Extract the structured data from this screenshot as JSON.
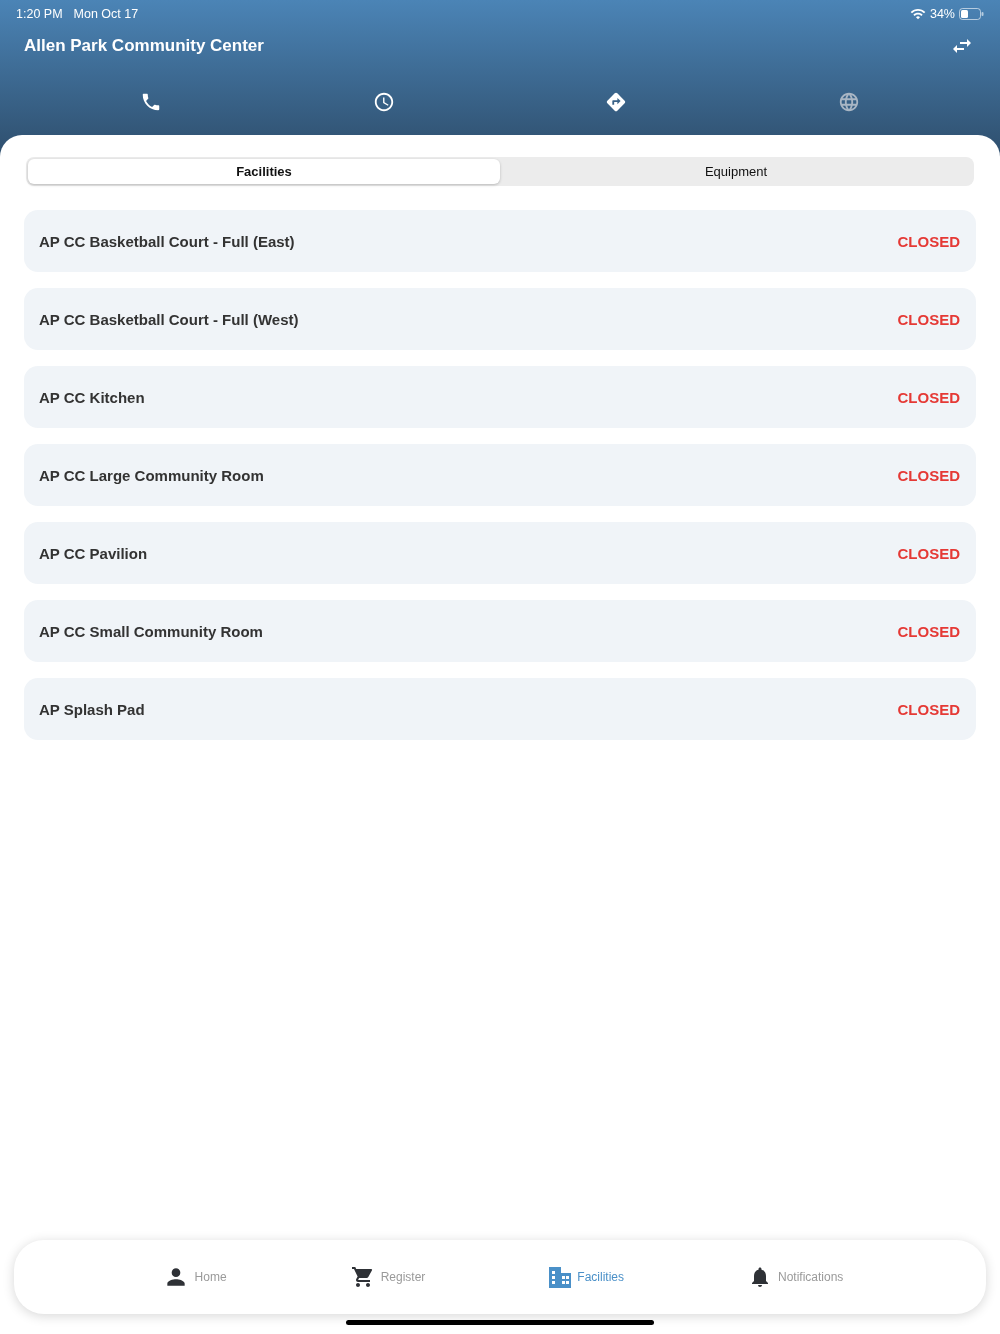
{
  "status_bar": {
    "time": "1:20 PM",
    "date": "Mon Oct 17",
    "battery": "34%"
  },
  "header": {
    "title": "Allen Park Community Center"
  },
  "actions": [
    {
      "kind": "phone",
      "disabled": false
    },
    {
      "kind": "hours",
      "disabled": false
    },
    {
      "kind": "directions",
      "disabled": false
    },
    {
      "kind": "website",
      "disabled": true
    }
  ],
  "tabs": [
    {
      "label": "Facilities",
      "selected": true
    },
    {
      "label": "Equipment",
      "selected": false
    }
  ],
  "facilities": [
    {
      "name": "AP CC Basketball Court - Full (East)",
      "status": "CLOSED"
    },
    {
      "name": "AP CC Basketball Court - Full (West)",
      "status": "CLOSED"
    },
    {
      "name": "AP CC Kitchen",
      "status": "CLOSED"
    },
    {
      "name": "AP CC Large Community Room",
      "status": "CLOSED"
    },
    {
      "name": "AP CC Pavilion",
      "status": "CLOSED"
    },
    {
      "name": "AP CC Small Community Room",
      "status": "CLOSED"
    },
    {
      "name": "AP Splash Pad",
      "status": "CLOSED"
    }
  ],
  "tab_bar": [
    {
      "kind": "home",
      "label": "Home",
      "selected": false
    },
    {
      "kind": "register",
      "label": "Register",
      "selected": false
    },
    {
      "kind": "facilities",
      "label": "Facilities",
      "selected": true
    },
    {
      "kind": "notifications",
      "label": "Notifications",
      "selected": false
    }
  ]
}
